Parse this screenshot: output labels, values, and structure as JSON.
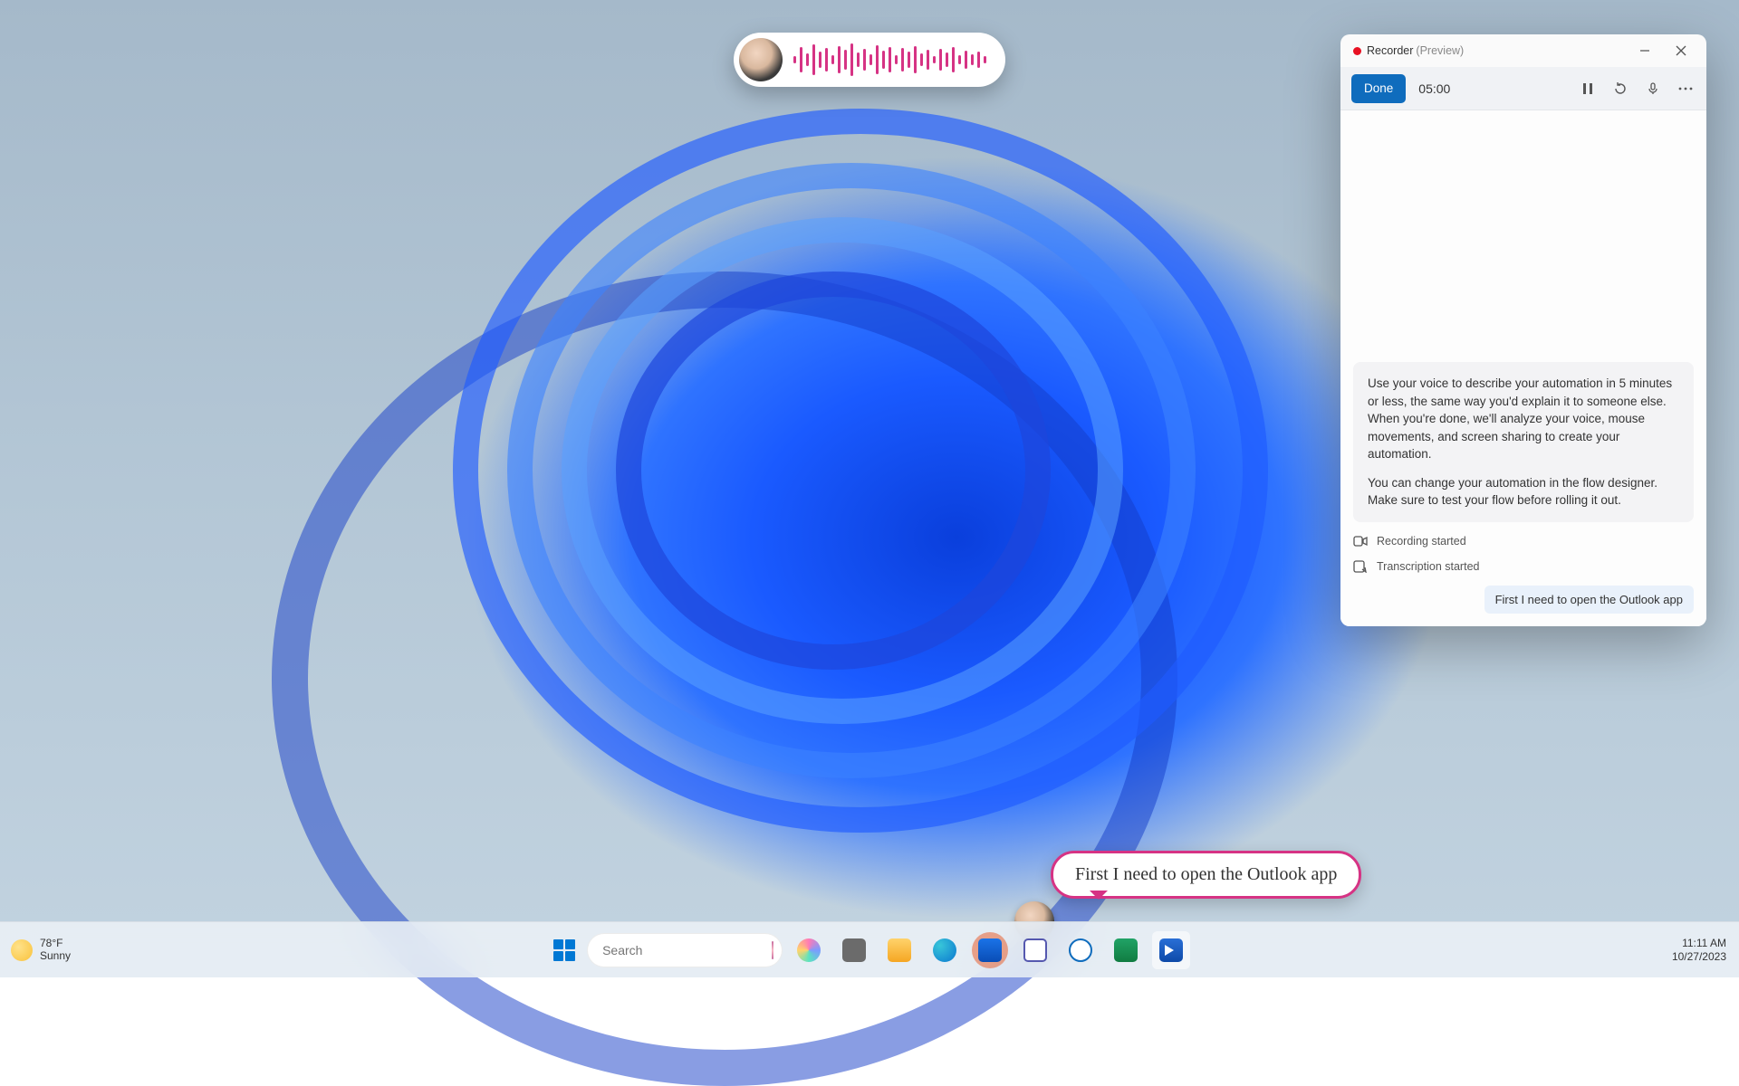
{
  "voice_pill": {
    "avatar_alt": "User avatar"
  },
  "recorder": {
    "title": "Recorder",
    "title_suffix": "(Preview)",
    "done_label": "Done",
    "time": "05:00",
    "hint_p1": "Use your voice to describe your automation in 5 minutes or less, the same way you'd explain it to someone else. When you're done, we'll analyze your voice, mouse movements, and screen sharing to create your automation.",
    "hint_p2": "You can change your automation in the flow designer. Make sure to test your flow before rolling it out.",
    "status_recording": "Recording started",
    "status_transcription": "Transcription started",
    "transcript_line": "First I need to open the Outlook app"
  },
  "cursor_bubble": "First I need to open the Outlook app",
  "taskbar": {
    "weather_temp": "78°F",
    "weather_desc": "Sunny",
    "search_placeholder": "Search",
    "time": "11:11 AM",
    "date": "10/27/2023"
  }
}
